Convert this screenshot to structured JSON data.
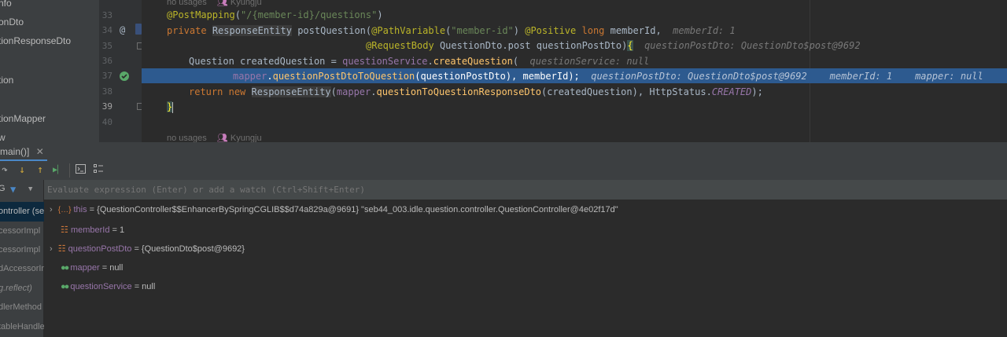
{
  "tree": {
    "items": [
      "nfo",
      "onDto",
      "tionResponseDto",
      "tion",
      "tionMapper",
      "w"
    ]
  },
  "gutter": {
    "lines": [
      "33",
      "34",
      "35",
      "36",
      "37",
      "38",
      "39",
      "40"
    ]
  },
  "editor": {
    "hint1_usages": "no usages",
    "hint1_author": "Kyungju",
    "line33": {
      "ann": "@PostMapping",
      "str": "\"/{member-id}/questions\""
    },
    "line34": {
      "k1": "private",
      "type": "ResponseEntity",
      "method": "postQuestion",
      "ann1": "@PathVariable",
      "str": "\"member-id\"",
      "ann2": "@Positive",
      "k2": "long",
      "param": "memberId",
      "hint": "memberId: 1"
    },
    "line35": {
      "ann": "@RequestBody",
      "type": "QuestionDto.post",
      "param": "questionPostDto",
      "hint": "questionPostDto: QuestionDto$post@9692"
    },
    "line36": {
      "type": "Question",
      "var": "createdQuestion",
      "field": "questionService",
      "method": "createQuestion",
      "hint": "questionService: null"
    },
    "line37": {
      "field": "mapper",
      "method": "questionPostDtoToQuestion",
      "arg1": "questionPostDto",
      "arg2": "memberId",
      "hint1": "questionPostDto: QuestionDto$post@9692",
      "hint2": "memberId: 1",
      "hint3": "mapper: null"
    },
    "line38": {
      "k1": "return",
      "k2": "new",
      "type": "ResponseEntity",
      "field": "mapper",
      "method": "questionToQuestionResponseDto",
      "arg": "createdQuestion",
      "enum_type": "HttpStatus",
      "enum_val": "CREATED"
    },
    "line39": "}",
    "hint2_usages": "no usages",
    "hint2_author": "Kyungju"
  },
  "debug": {
    "tab_label": "main()]",
    "eval_placeholder": "Evaluate expression (Enter) or add a watch (Ctrl+Shift+Enter)",
    "frames": [
      "ontroller (se",
      "cessorImpl",
      "cessorImpl",
      "dAccessorIm",
      "g.reflect)",
      "dlerMethod",
      "tableHandle"
    ],
    "variables": [
      {
        "name": "this",
        "value": "= {QuestionController$$EnhancerBySpringCGLIB$$d74a829a@9691} \"seb44_003.idle.question.controller.QuestionController@4e02f17d\"",
        "icon": "object-icon",
        "expandable": true
      },
      {
        "name": "memberId",
        "value": "= 1",
        "icon": "primitive-icon",
        "expandable": false
      },
      {
        "name": "questionPostDto",
        "value": "= {QuestionDto$post@9692}",
        "icon": "primitive-icon",
        "expandable": true
      },
      {
        "name": "mapper",
        "value": "= null",
        "icon": "watch-icon",
        "expandable": false
      },
      {
        "name": "questionService",
        "value": "= null",
        "icon": "watch-icon",
        "expandable": false
      }
    ]
  },
  "colors": {
    "accent": "#2d5a8f",
    "keyword": "#cc7832",
    "annotation": "#bbb529",
    "string": "#6a8759",
    "method": "#ffc66d",
    "field": "#9876aa"
  }
}
